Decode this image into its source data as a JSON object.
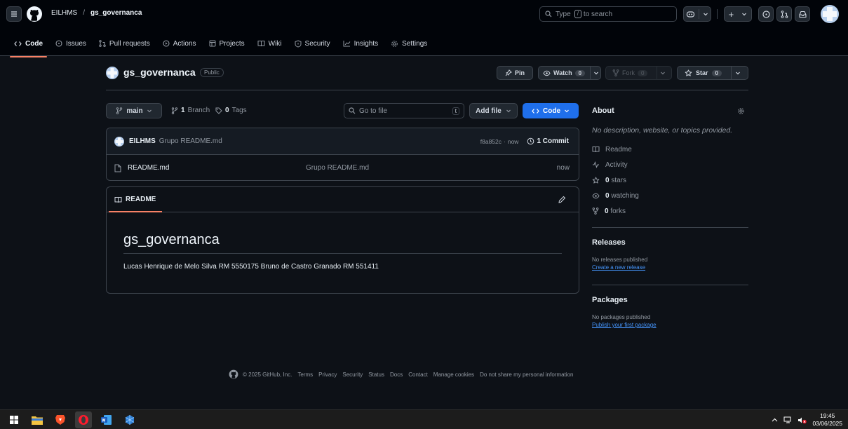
{
  "header": {
    "owner": "EILHMS",
    "separator": "/",
    "repo": "gs_governanca",
    "search_pre": "Type",
    "search_key": "/",
    "search_post": "to search",
    "plus": "+"
  },
  "tabs": [
    {
      "label": "Code",
      "icon": "code-icon"
    },
    {
      "label": "Issues",
      "icon": "issue-icon"
    },
    {
      "label": "Pull requests",
      "icon": "pull-request-icon"
    },
    {
      "label": "Actions",
      "icon": "play-icon"
    },
    {
      "label": "Projects",
      "icon": "table-icon"
    },
    {
      "label": "Wiki",
      "icon": "book-icon"
    },
    {
      "label": "Security",
      "icon": "shield-icon"
    },
    {
      "label": "Insights",
      "icon": "graph-icon"
    },
    {
      "label": "Settings",
      "icon": "gear-icon"
    }
  ],
  "repo": {
    "name": "gs_governanca",
    "visibility": "Public",
    "pin": "Pin",
    "watch": "Watch",
    "watch_count": "0",
    "fork": "Fork",
    "fork_count": "0",
    "star": "Star",
    "star_count": "0"
  },
  "toolbar": {
    "branch": "main",
    "branch_count": "1",
    "branch_label": "Branch",
    "tag_count": "0",
    "tag_label": "Tags",
    "goto_placeholder": "Go to file",
    "goto_key": "t",
    "add_file": "Add file",
    "code": "Code"
  },
  "commit": {
    "author": "EILHMS",
    "message": "Grupo README.md",
    "hash": "f8a852c",
    "sep": "·",
    "time": "now",
    "count_label": "1 Commit"
  },
  "files": [
    {
      "name": "README.md",
      "message": "Grupo README.md",
      "time": "now"
    }
  ],
  "readme": {
    "tab": "README",
    "title": "gs_governanca",
    "body": "Lucas Henrique de Melo Silva RM 5550175 Bruno de Castro Granado RM 551411"
  },
  "about": {
    "title": "About",
    "description": "No description, website, or topics provided.",
    "readme": "Readme",
    "activity": "Activity",
    "stars_count": "0",
    "stars_label": "stars",
    "watching_count": "0",
    "watching_label": "watching",
    "forks_count": "0",
    "forks_label": "forks"
  },
  "releases": {
    "title": "Releases",
    "empty": "No releases published",
    "link": "Create a new release"
  },
  "packages": {
    "title": "Packages",
    "empty": "No packages published",
    "link": "Publish your first package"
  },
  "footer": {
    "copyright": "© 2025 GitHub, Inc.",
    "links": [
      "Terms",
      "Privacy",
      "Security",
      "Status",
      "Docs",
      "Contact",
      "Manage cookies",
      "Do not share my personal information"
    ]
  },
  "taskbar": {
    "time": "19:45",
    "date": "03/06/2025"
  },
  "colors": {
    "accent_blue": "#1f6feb",
    "active_tab_underline": "#f78166",
    "link": "#4493f8"
  }
}
